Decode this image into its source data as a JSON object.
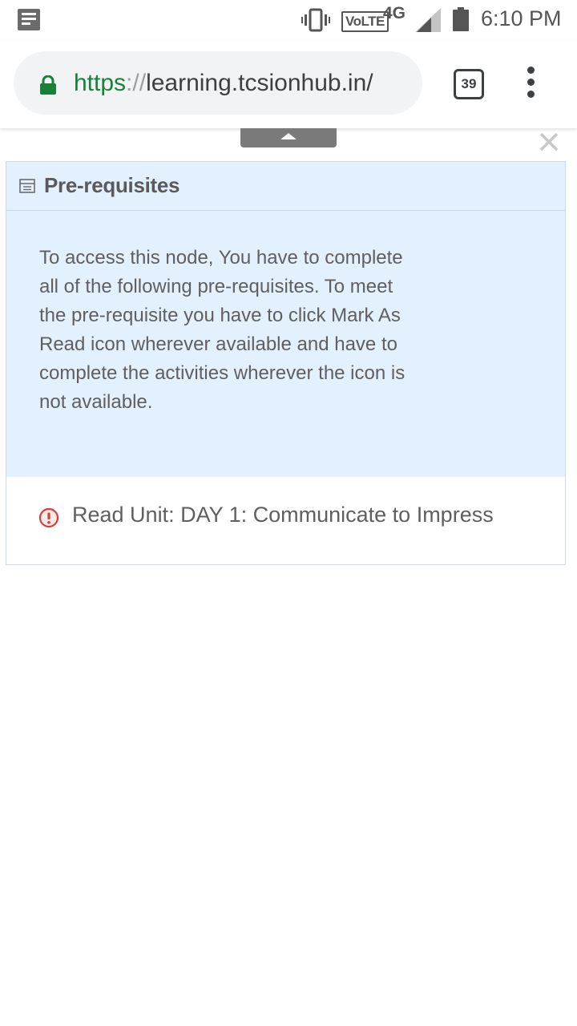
{
  "status_bar": {
    "network_label": "VoLTE",
    "network_type": "4G",
    "time": "6:10 PM"
  },
  "browser": {
    "url_scheme": "https",
    "url_separator": "://",
    "url_host": "learning.tcsionhub.in/",
    "tab_count": "39"
  },
  "panel": {
    "title": "Pre-requisites",
    "description": "To access this node, You have to complete all of the following pre-requisites. To meet the pre-requisite you have to click Mark As Read icon wherever available and have to complete the activities wherever the icon is not available.",
    "items": [
      {
        "label": "Read Unit: DAY 1: Communicate to Impress",
        "icon": "alert-icon"
      }
    ]
  },
  "colors": {
    "panel_bg": "#e3f0fd",
    "panel_border": "#c9d9e8",
    "url_green": "#188038",
    "alert_red": "#e53935"
  }
}
